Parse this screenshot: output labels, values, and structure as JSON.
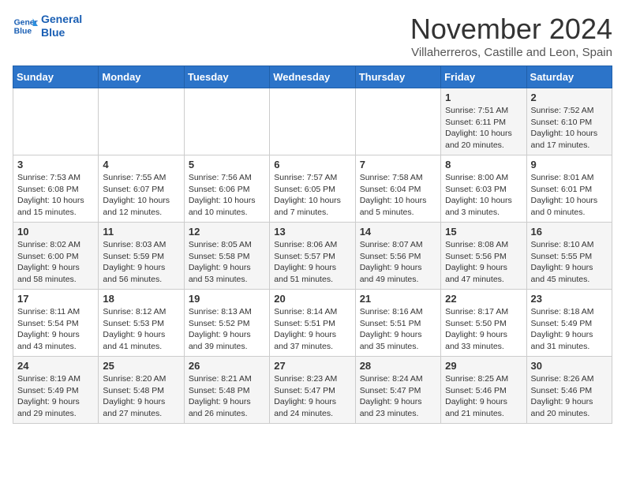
{
  "header": {
    "logo_line1": "General",
    "logo_line2": "Blue",
    "month_title": "November 2024",
    "location": "Villaherreros, Castille and Leon, Spain"
  },
  "days_of_week": [
    "Sunday",
    "Monday",
    "Tuesday",
    "Wednesday",
    "Thursday",
    "Friday",
    "Saturday"
  ],
  "weeks": [
    [
      {
        "day": "",
        "info": ""
      },
      {
        "day": "",
        "info": ""
      },
      {
        "day": "",
        "info": ""
      },
      {
        "day": "",
        "info": ""
      },
      {
        "day": "",
        "info": ""
      },
      {
        "day": "1",
        "info": "Sunrise: 7:51 AM\nSunset: 6:11 PM\nDaylight: 10 hours and 20 minutes."
      },
      {
        "day": "2",
        "info": "Sunrise: 7:52 AM\nSunset: 6:10 PM\nDaylight: 10 hours and 17 minutes."
      }
    ],
    [
      {
        "day": "3",
        "info": "Sunrise: 7:53 AM\nSunset: 6:08 PM\nDaylight: 10 hours and 15 minutes."
      },
      {
        "day": "4",
        "info": "Sunrise: 7:55 AM\nSunset: 6:07 PM\nDaylight: 10 hours and 12 minutes."
      },
      {
        "day": "5",
        "info": "Sunrise: 7:56 AM\nSunset: 6:06 PM\nDaylight: 10 hours and 10 minutes."
      },
      {
        "day": "6",
        "info": "Sunrise: 7:57 AM\nSunset: 6:05 PM\nDaylight: 10 hours and 7 minutes."
      },
      {
        "day": "7",
        "info": "Sunrise: 7:58 AM\nSunset: 6:04 PM\nDaylight: 10 hours and 5 minutes."
      },
      {
        "day": "8",
        "info": "Sunrise: 8:00 AM\nSunset: 6:03 PM\nDaylight: 10 hours and 3 minutes."
      },
      {
        "day": "9",
        "info": "Sunrise: 8:01 AM\nSunset: 6:01 PM\nDaylight: 10 hours and 0 minutes."
      }
    ],
    [
      {
        "day": "10",
        "info": "Sunrise: 8:02 AM\nSunset: 6:00 PM\nDaylight: 9 hours and 58 minutes."
      },
      {
        "day": "11",
        "info": "Sunrise: 8:03 AM\nSunset: 5:59 PM\nDaylight: 9 hours and 56 minutes."
      },
      {
        "day": "12",
        "info": "Sunrise: 8:05 AM\nSunset: 5:58 PM\nDaylight: 9 hours and 53 minutes."
      },
      {
        "day": "13",
        "info": "Sunrise: 8:06 AM\nSunset: 5:57 PM\nDaylight: 9 hours and 51 minutes."
      },
      {
        "day": "14",
        "info": "Sunrise: 8:07 AM\nSunset: 5:56 PM\nDaylight: 9 hours and 49 minutes."
      },
      {
        "day": "15",
        "info": "Sunrise: 8:08 AM\nSunset: 5:56 PM\nDaylight: 9 hours and 47 minutes."
      },
      {
        "day": "16",
        "info": "Sunrise: 8:10 AM\nSunset: 5:55 PM\nDaylight: 9 hours and 45 minutes."
      }
    ],
    [
      {
        "day": "17",
        "info": "Sunrise: 8:11 AM\nSunset: 5:54 PM\nDaylight: 9 hours and 43 minutes."
      },
      {
        "day": "18",
        "info": "Sunrise: 8:12 AM\nSunset: 5:53 PM\nDaylight: 9 hours and 41 minutes."
      },
      {
        "day": "19",
        "info": "Sunrise: 8:13 AM\nSunset: 5:52 PM\nDaylight: 9 hours and 39 minutes."
      },
      {
        "day": "20",
        "info": "Sunrise: 8:14 AM\nSunset: 5:51 PM\nDaylight: 9 hours and 37 minutes."
      },
      {
        "day": "21",
        "info": "Sunrise: 8:16 AM\nSunset: 5:51 PM\nDaylight: 9 hours and 35 minutes."
      },
      {
        "day": "22",
        "info": "Sunrise: 8:17 AM\nSunset: 5:50 PM\nDaylight: 9 hours and 33 minutes."
      },
      {
        "day": "23",
        "info": "Sunrise: 8:18 AM\nSunset: 5:49 PM\nDaylight: 9 hours and 31 minutes."
      }
    ],
    [
      {
        "day": "24",
        "info": "Sunrise: 8:19 AM\nSunset: 5:49 PM\nDaylight: 9 hours and 29 minutes."
      },
      {
        "day": "25",
        "info": "Sunrise: 8:20 AM\nSunset: 5:48 PM\nDaylight: 9 hours and 27 minutes."
      },
      {
        "day": "26",
        "info": "Sunrise: 8:21 AM\nSunset: 5:48 PM\nDaylight: 9 hours and 26 minutes."
      },
      {
        "day": "27",
        "info": "Sunrise: 8:23 AM\nSunset: 5:47 PM\nDaylight: 9 hours and 24 minutes."
      },
      {
        "day": "28",
        "info": "Sunrise: 8:24 AM\nSunset: 5:47 PM\nDaylight: 9 hours and 23 minutes."
      },
      {
        "day": "29",
        "info": "Sunrise: 8:25 AM\nSunset: 5:46 PM\nDaylight: 9 hours and 21 minutes."
      },
      {
        "day": "30",
        "info": "Sunrise: 8:26 AM\nSunset: 5:46 PM\nDaylight: 9 hours and 20 minutes."
      }
    ]
  ]
}
